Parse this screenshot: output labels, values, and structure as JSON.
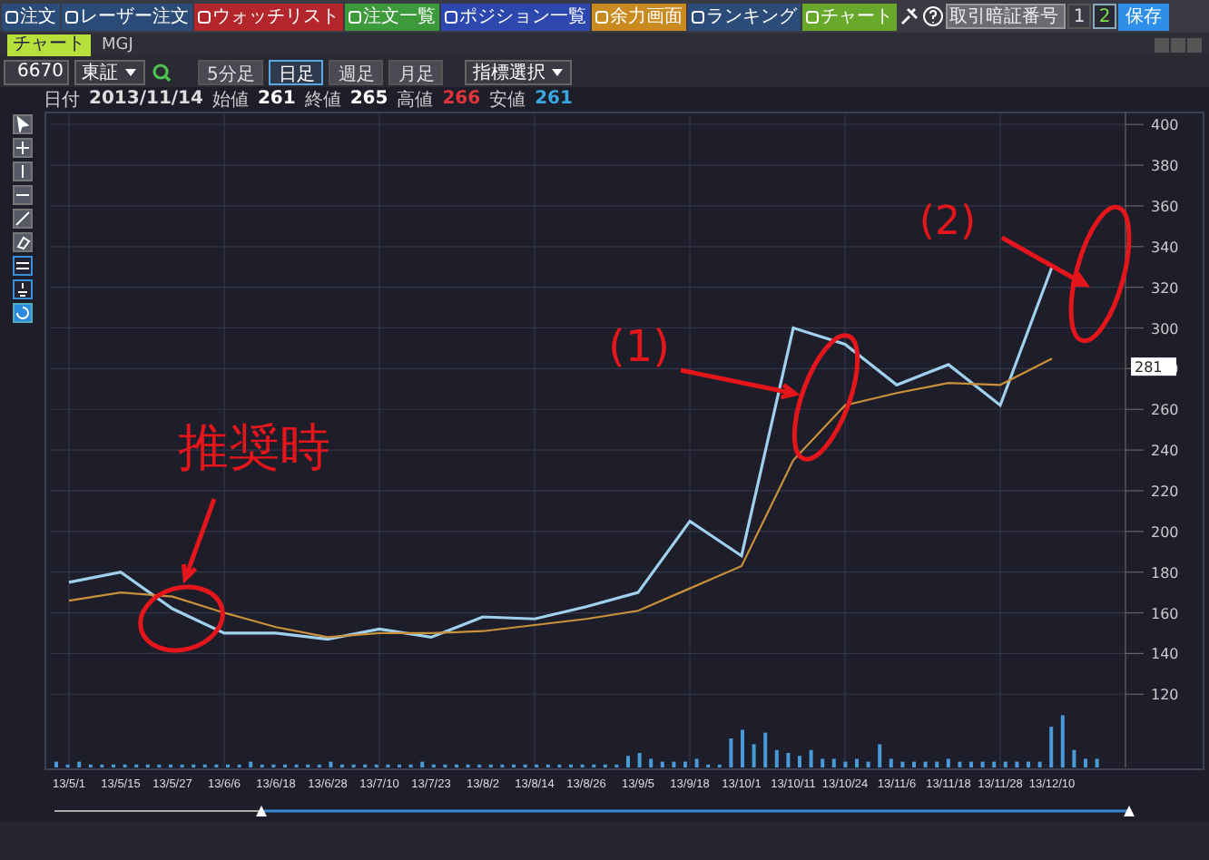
{
  "toolbar": {
    "buttons": [
      {
        "label": "注文",
        "color": "#2b4c78"
      },
      {
        "label": "レーザー注文",
        "color": "#2b4c78"
      },
      {
        "label": "ウォッチリスト",
        "color": "#b3262c"
      },
      {
        "label": "注文一覧",
        "color": "#3c9a3a"
      },
      {
        "label": "ポジション一覧",
        "color": "#2c47ad"
      },
      {
        "label": "余力画面",
        "color": "#c98a1f"
      },
      {
        "label": "ランキング",
        "color": "#2b4c78"
      },
      {
        "label": "チャート",
        "color": "#68a82b"
      }
    ],
    "pin_field": {
      "placeholder": "取引暗証番号"
    },
    "pages": [
      {
        "label": "1",
        "selected": false
      },
      {
        "label": "2",
        "selected": true
      }
    ],
    "save_button": "保存"
  },
  "window": {
    "tab": "チャート",
    "title": "MGJ"
  },
  "controls": {
    "code": "6670",
    "market": "東証",
    "periods": [
      {
        "label": "5分足",
        "selected": false
      },
      {
        "label": "日足",
        "selected": true
      },
      {
        "label": "週足",
        "selected": false
      },
      {
        "label": "月足",
        "selected": false
      }
    ],
    "indicator": "指標選択"
  },
  "quote": {
    "date_label": "日付",
    "date": "2013/11/14",
    "items": [
      {
        "label": "始値",
        "value": "261",
        "color": "#ffffff"
      },
      {
        "label": "終値",
        "value": "265",
        "color": "#ffffff"
      },
      {
        "label": "高値",
        "value": "266",
        "color": "#e0353a"
      },
      {
        "label": "安値",
        "value": "261",
        "color": "#3aa7e0"
      }
    ]
  },
  "chart": {
    "last_price": "281",
    "chart_data": {
      "type": "line",
      "categories": [
        "13/5/1",
        "13/5/15",
        "13/5/27",
        "13/6/6",
        "13/6/18",
        "13/6/28",
        "13/7/10",
        "13/7/23",
        "13/8/2",
        "13/8/14",
        "13/8/26",
        "13/9/5",
        "13/9/18",
        "13/10/1",
        "13/10/11",
        "13/10/24",
        "13/11/6",
        "13/11/18",
        "13/11/28",
        "13/12/10"
      ],
      "series": [
        {
          "color": "#9fd0ee",
          "values": [
            175,
            180,
            162,
            150,
            150,
            147,
            152,
            148,
            158,
            157,
            163,
            170,
            205,
            188,
            300,
            292,
            272,
            282,
            262,
            330
          ]
        },
        {
          "color": "#c8913a",
          "values": [
            166,
            170,
            168,
            160,
            153,
            148,
            150,
            150,
            151,
            154,
            157,
            161,
            172,
            183,
            235,
            262,
            268,
            273,
            272,
            285
          ]
        }
      ],
      "ylim": [
        84,
        405
      ],
      "grid": true,
      "yticks": [
        120,
        140,
        160,
        180,
        200,
        220,
        240,
        260,
        280,
        300,
        320,
        340,
        360,
        380,
        400
      ]
    }
  },
  "annotations": [
    {
      "text": "推奨時"
    },
    {
      "text": "(1)"
    },
    {
      "text": "(2)"
    }
  ]
}
